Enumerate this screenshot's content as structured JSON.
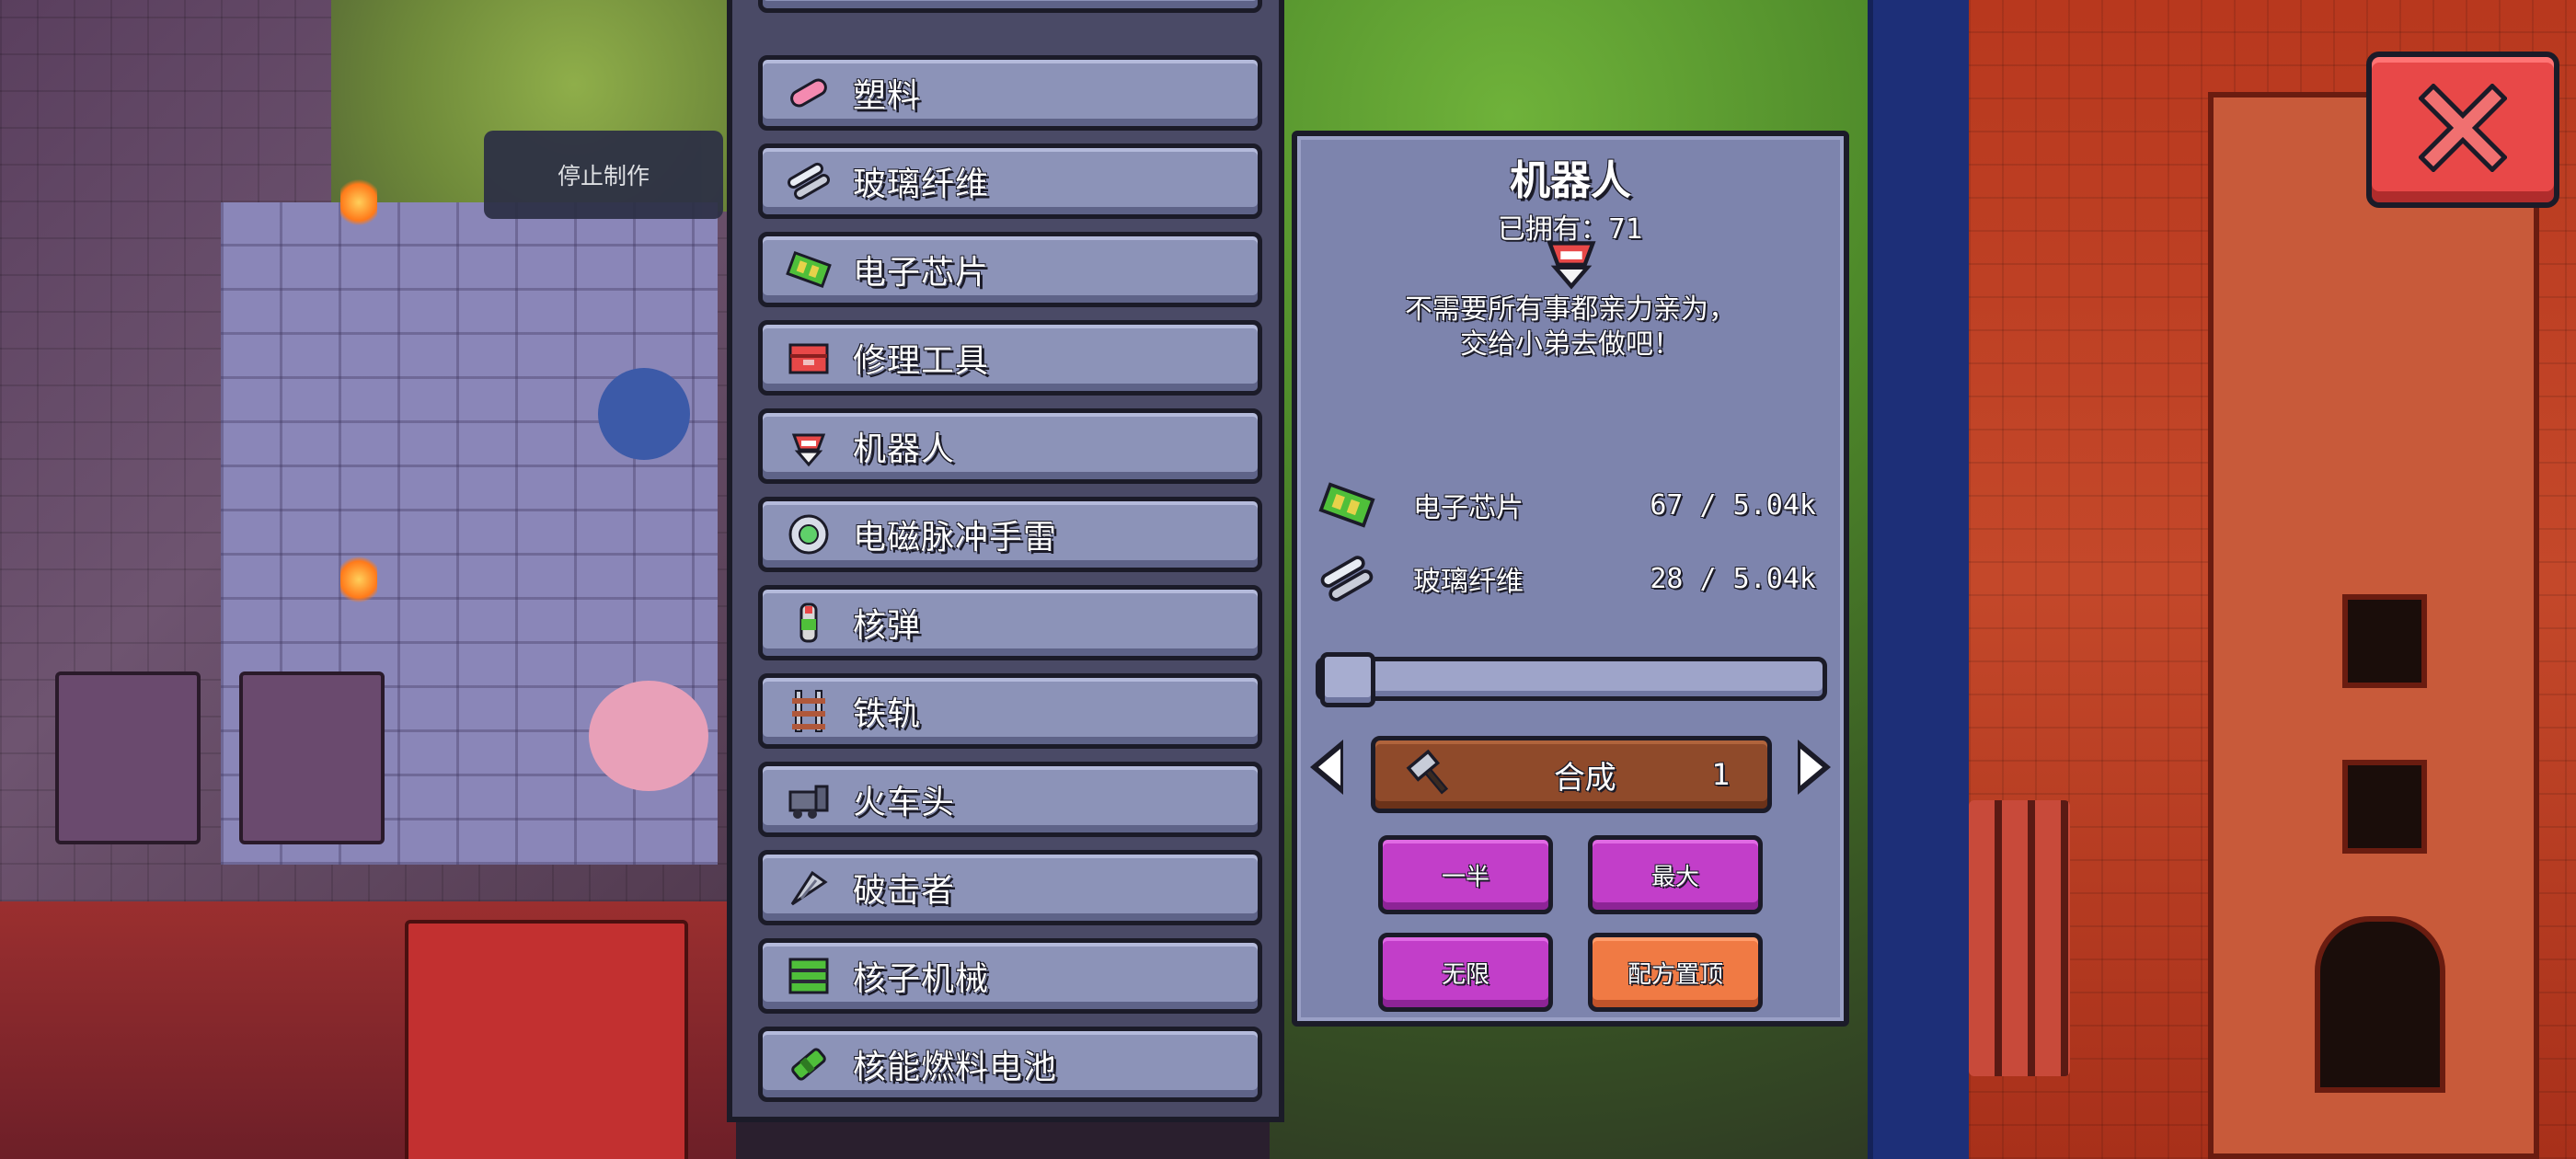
{
  "stop_button": {
    "label": "停止制作"
  },
  "recipes": {
    "items": [
      {
        "label": "塑料",
        "icon": "plastic-icon"
      },
      {
        "label": "玻璃纤维",
        "icon": "glass-fiber-icon"
      },
      {
        "label": "电子芯片",
        "icon": "chip-icon"
      },
      {
        "label": "修理工具",
        "icon": "repair-tool-icon"
      },
      {
        "label": "机器人",
        "icon": "robot-icon"
      },
      {
        "label": "电磁脉冲手雷",
        "icon": "emp-grenade-icon"
      },
      {
        "label": "核弹",
        "icon": "nuke-icon"
      },
      {
        "label": "铁轨",
        "icon": "rail-icon"
      },
      {
        "label": "火车头",
        "icon": "locomotive-icon"
      },
      {
        "label": "破击者",
        "icon": "breaker-icon"
      },
      {
        "label": "核子机械",
        "icon": "nuclear-machine-icon"
      },
      {
        "label": "核能燃料电池",
        "icon": "fuel-cell-icon"
      }
    ]
  },
  "detail": {
    "title": "机器人",
    "owned": "已拥有：71",
    "description_line1": "不需要所有事都亲力亲为，",
    "description_line2": "交给小弟去做吧！",
    "ingredients": [
      {
        "name": "电子芯片",
        "count": "67 / 5.04k",
        "icon": "chip-icon"
      },
      {
        "name": "玻璃纤维",
        "count": "28 / 5.04k",
        "icon": "glass-fiber-icon"
      }
    ],
    "slider_fraction": 0.0,
    "craft": {
      "label": "合成",
      "quantity": "1",
      "icon": "hammer-icon"
    },
    "half_label": "一半",
    "max_label": "最大",
    "infinite_label": "无限",
    "pin_label": "配方置顶"
  },
  "colors": {
    "panel": "#7d84ad",
    "list_item": "#8c93b8",
    "purple_button": "#c23ec9",
    "orange_button": "#f07a44",
    "craft_button": "#8f4a2a",
    "close_button": "#e84848"
  }
}
